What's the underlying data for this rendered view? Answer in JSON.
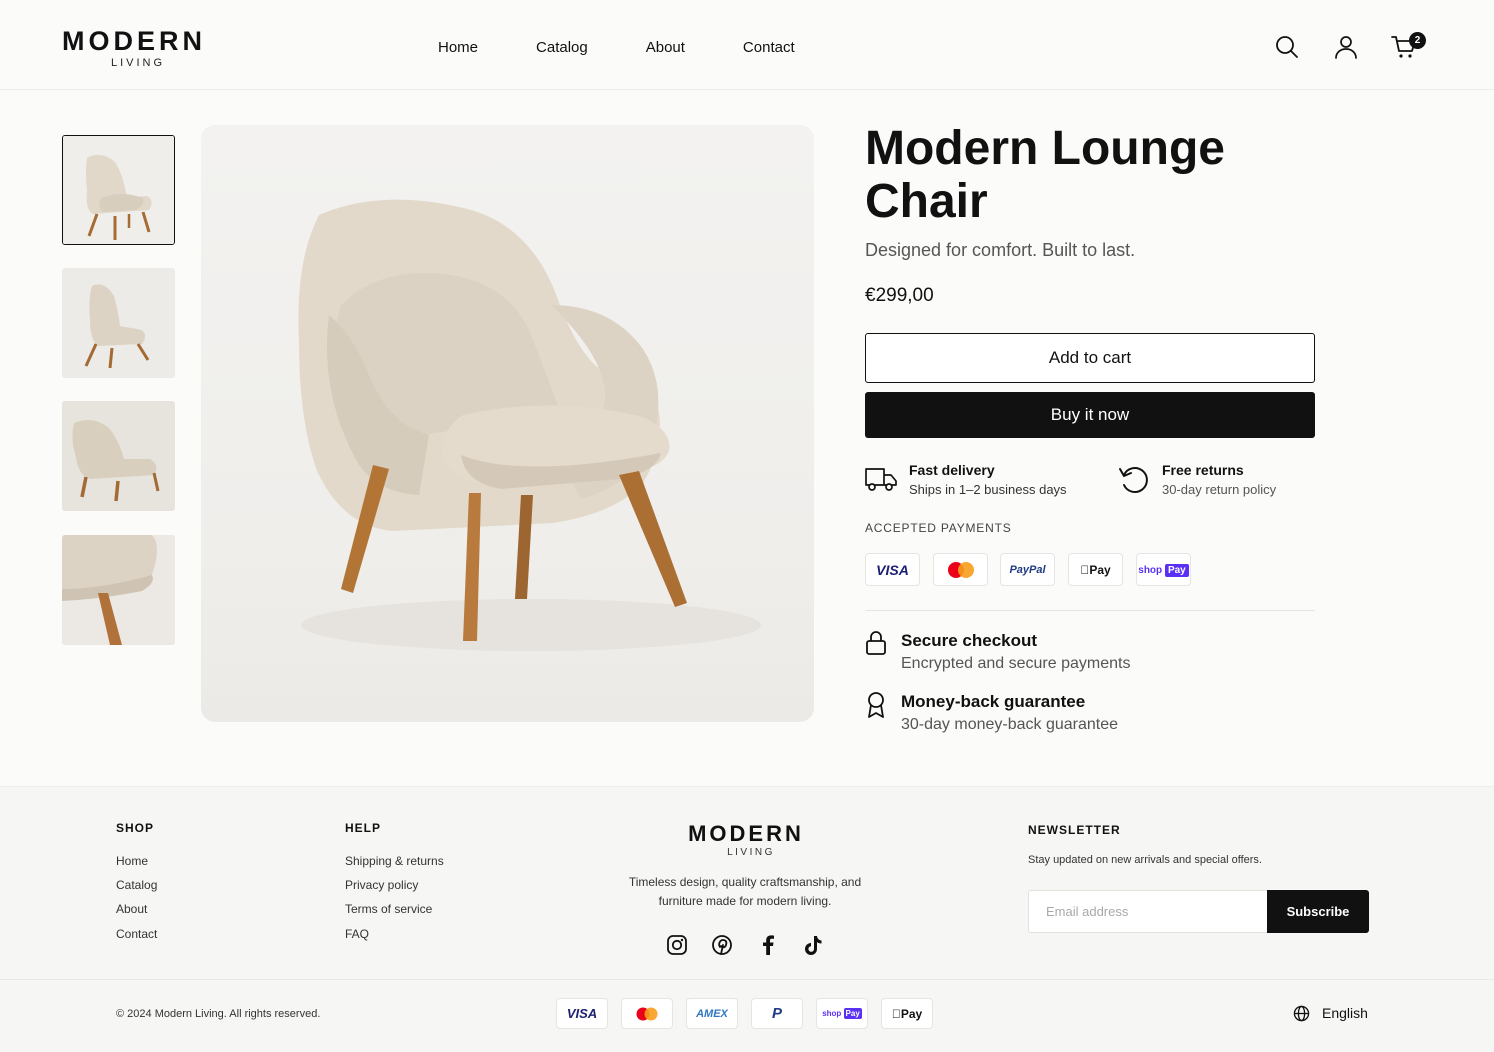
{
  "brand": {
    "name": "MODERN",
    "sub": "LIVING"
  },
  "nav": {
    "items": [
      "Home",
      "Catalog",
      "About",
      "Contact"
    ]
  },
  "cart": {
    "count": "2"
  },
  "icons": {
    "search": "search-icon",
    "account": "user-icon",
    "cart": "cart-icon"
  },
  "gallery": {
    "thumbnails": 4,
    "active_index": 0
  },
  "product": {
    "title": "Modern Lounge Chair",
    "tagline": "Designed for comfort. Built to last.",
    "price": "€299,00",
    "add_to_cart": "Add to cart",
    "buy_now": "Buy it now"
  },
  "features": [
    {
      "icon": "truck-icon",
      "title": "Fast delivery",
      "sub": "Ships in 1–2 business days"
    },
    {
      "icon": "return-icon",
      "title": "Free returns",
      "sub": "30-day return policy"
    }
  ],
  "payments": {
    "heading": "ACCEPTED PAYMENTS",
    "methods": [
      "VISA",
      "Mastercard",
      "PayPal",
      "Apple Pay",
      "Shop Pay"
    ]
  },
  "assurances": [
    {
      "icon": "lock-icon",
      "title": "Secure checkout",
      "sub": "Encrypted and secure payments"
    },
    {
      "icon": "award-icon",
      "title": "Money-back guarantee",
      "sub": "30-day money-back guarantee"
    }
  ],
  "footer": {
    "shop": {
      "title": "SHOP",
      "links": [
        "Home",
        "Catalog",
        "About",
        "Contact"
      ]
    },
    "help": {
      "title": "HELP",
      "links": [
        "Shipping & returns",
        "Privacy policy",
        "Terms of service",
        "FAQ"
      ]
    },
    "description": "Timeless design, quality craftsmanship, and furniture made for modern living.",
    "social": [
      "instagram-icon",
      "pinterest-icon",
      "facebook-icon",
      "tiktok-icon"
    ],
    "newsletter": {
      "title": "NEWSLETTER",
      "text": "Stay updated on new arrivals and special offers.",
      "placeholder": "Email address",
      "button": "Subscribe"
    },
    "copyright": "© 2024 Modern Living. All rights reserved.",
    "payments": [
      "VISA",
      "Mastercard",
      "American Express",
      "PayPal",
      "Shop Pay",
      "Apple Pay"
    ],
    "language": "English"
  },
  "colors": {
    "text": "#111111",
    "muted": "#555555",
    "background": "#fbfbfa",
    "button": "#111111",
    "chair": "#e4dccf",
    "wood": "#b97a3e"
  }
}
